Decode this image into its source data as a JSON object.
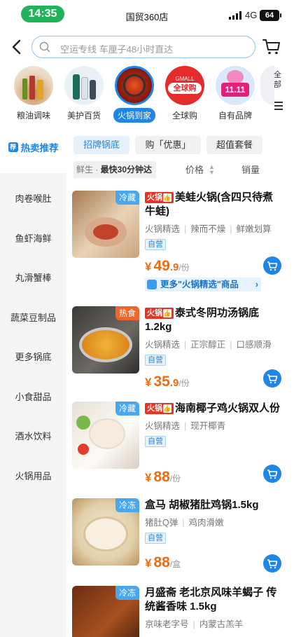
{
  "status": {
    "time": "14:35",
    "carrier": "国贸360店",
    "network": "4G",
    "battery": "64"
  },
  "search": {
    "placeholder": "空运专线 车厘子48小时直达"
  },
  "categories": [
    {
      "label": "粮油调味"
    },
    {
      "label": "美护百货"
    },
    {
      "label": "火锅到家"
    },
    {
      "label": "全球购",
      "logo": "GMALL 全球购"
    },
    {
      "label": "自有品牌",
      "logo": "11.11"
    }
  ],
  "more_hint": "全部",
  "sidebar": {
    "items": [
      {
        "label": "热卖推荐",
        "tag": "荐"
      },
      {
        "label": "肉卷喉肚"
      },
      {
        "label": "鱼虾海鲜"
      },
      {
        "label": "丸滑蟹棒"
      },
      {
        "label": "蔬菜豆制品"
      },
      {
        "label": "更多锅底"
      },
      {
        "label": "小食甜品"
      },
      {
        "label": "酒水饮料"
      },
      {
        "label": "火锅用品"
      }
    ]
  },
  "subtabs": [
    "招牌锅底",
    "购「优惠」",
    "超值套餐"
  ],
  "sort": {
    "fresh_prefix": "鲜生 · ",
    "fresh_main": "最快30分钟达",
    "price": "价格",
    "sales": "销量"
  },
  "products": [
    {
      "tag": "冷藏",
      "badge": "火锅",
      "title": "美蛙火锅(含四只待煮牛蛙)",
      "tags": [
        "火锅精选",
        "辣而不燥",
        "鲜嫩划算"
      ],
      "self_run": "自营",
      "price_int": "49",
      "price_dec": ".9",
      "unit": "/份",
      "more": "更多\"火锅精选\"商品"
    },
    {
      "tag": "热食",
      "badge": "火锅",
      "title": "泰式冬阴功汤锅底1.2kg",
      "tags": [
        "火锅精选",
        "正宗醇正",
        "口感顺滑"
      ],
      "self_run": "自营",
      "price_int": "35",
      "price_dec": ".9",
      "unit": "/份"
    },
    {
      "tag": "冷藏",
      "badge": "火锅",
      "title": "海南椰子鸡火锅双人份",
      "tags": [
        "火锅精选",
        "现开椰青"
      ],
      "self_run": "自营",
      "price_int": "88",
      "price_dec": "",
      "unit": "/份"
    },
    {
      "tag": "冷冻",
      "title": "盒马 胡椒猪肚鸡锅1.5kg",
      "tags": [
        "猪肚Q弹",
        "鸡肉滑嫩"
      ],
      "self_run": "自营",
      "price_int": "88",
      "price_dec": "",
      "unit": "/盒"
    },
    {
      "tag": "冷冻",
      "title": "月盛斋 老北京风味羊蝎子 传统酱香味 1.5kg",
      "tags": [
        "京味老字号",
        "内蒙古羔羊"
      ]
    }
  ],
  "colors": {
    "accent": "#1f86e8",
    "price": "#f06a0f",
    "hotpot_badge": "#e63322",
    "status_green": "#1fb35a"
  }
}
